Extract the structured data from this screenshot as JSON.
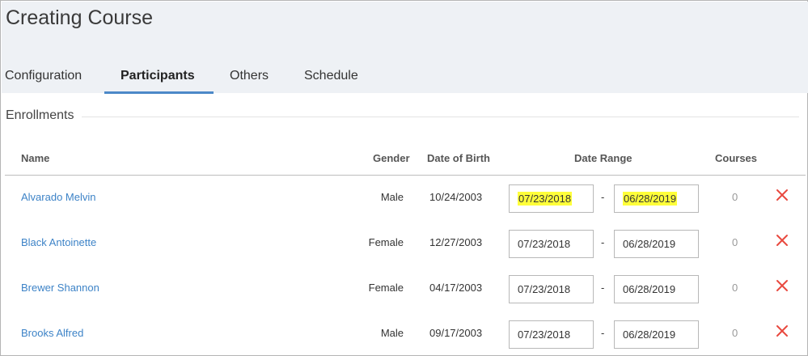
{
  "page": {
    "title": "Creating Course"
  },
  "tabs": [
    {
      "label": "Configuration"
    },
    {
      "label": "Participants"
    },
    {
      "label": "Others"
    },
    {
      "label": "Schedule"
    }
  ],
  "active_tab": "Participants",
  "enrollments": {
    "legend": "Enrollments",
    "columns": {
      "name": "Name",
      "gender": "Gender",
      "dob": "Date of Birth",
      "date_range": "Date Range",
      "courses": "Courses"
    },
    "separator": "-",
    "rows": [
      {
        "name": "Alvarado Melvin",
        "gender": "Male",
        "dob": "10/24/2003",
        "start": "07/23/2018",
        "end": "06/28/2019",
        "courses": "0"
      },
      {
        "name": "Black Antoinette",
        "gender": "Female",
        "dob": "12/27/2003",
        "start": "07/23/2018",
        "end": "06/28/2019",
        "courses": "0"
      },
      {
        "name": "Brewer Shannon",
        "gender": "Female",
        "dob": "04/17/2003",
        "start": "07/23/2018",
        "end": "06/28/2019",
        "courses": "0"
      },
      {
        "name": "Brooks Alfred",
        "gender": "Male",
        "dob": "09/17/2003",
        "start": "07/23/2018",
        "end": "06/28/2019",
        "courses": "0"
      }
    ]
  },
  "colors": {
    "accent": "#4c89c8",
    "link": "#3d83c7",
    "delete": "#e8493f",
    "highlight": "#ffff3a",
    "header_bg": "#eef1f5"
  },
  "icons": {
    "delete": "close-icon"
  }
}
